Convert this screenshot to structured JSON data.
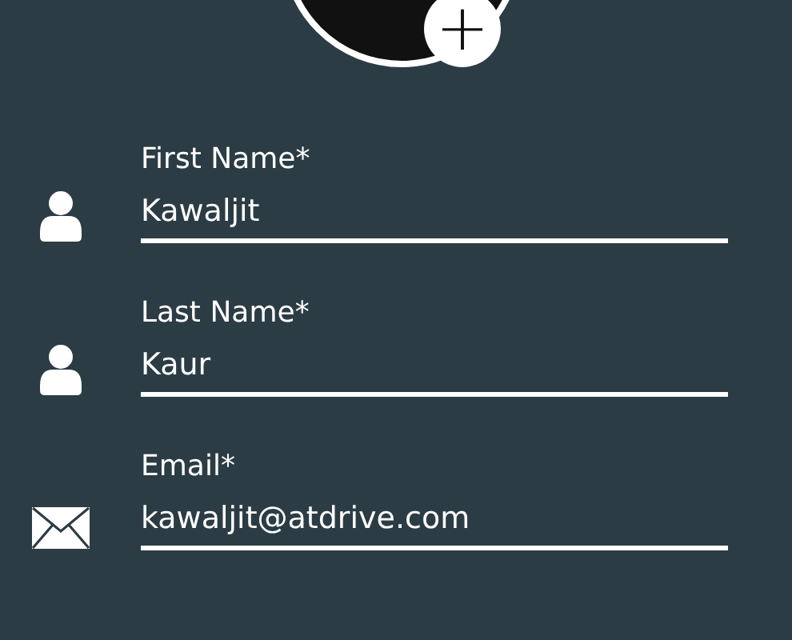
{
  "avatar": {
    "add_button": "+"
  },
  "fields": [
    {
      "kind": "person",
      "label": "First Name*",
      "value": "Kawaljit"
    },
    {
      "kind": "person",
      "label": "Last Name*",
      "value": "Kaur"
    },
    {
      "kind": "email",
      "label": "Email*",
      "value": "kawaljit@atdrive.com"
    }
  ]
}
